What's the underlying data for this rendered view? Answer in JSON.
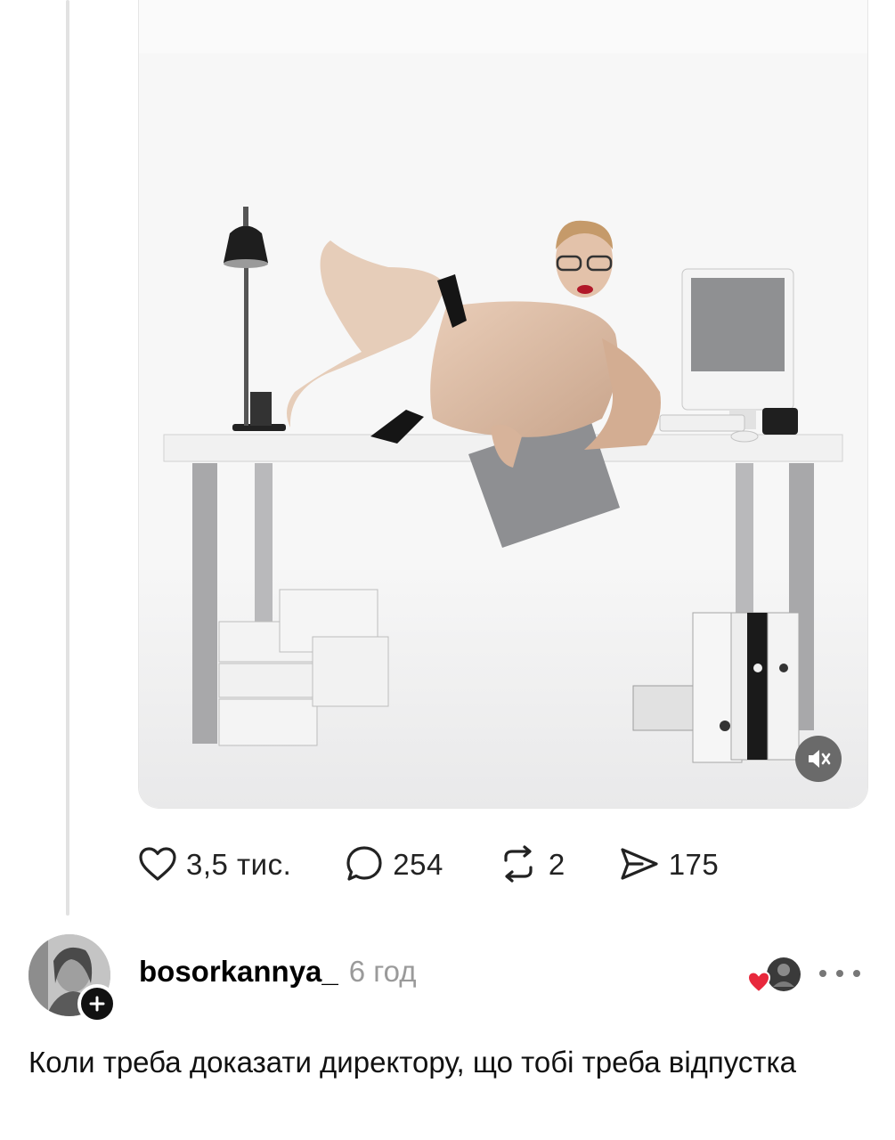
{
  "post_stats": {
    "likes": "3,5 тис.",
    "replies": "254",
    "reposts": "2",
    "shares": "175"
  },
  "reply_post": {
    "username": "bosorkannya_",
    "time_ago": "6 год",
    "text": "Коли треба доказати директору, що тобі треба відпустка"
  },
  "colors": {
    "heart_badge": "#e8283c",
    "text_muted": "#9a9a9a",
    "icon": "#222222"
  },
  "icons": [
    "heart-icon",
    "comment-icon",
    "repost-icon",
    "share-icon",
    "mute-icon",
    "plus-icon",
    "more-icon"
  ]
}
